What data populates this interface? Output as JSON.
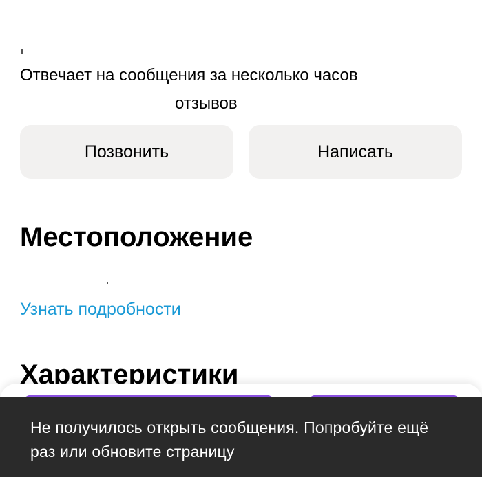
{
  "seller": {
    "response_time": "Отвечает на сообщения за несколько часов",
    "reviews_label": "отзывов"
  },
  "actions": {
    "call_label": "Позвонить",
    "write_label": "Написать"
  },
  "location": {
    "title": "Местоположение",
    "details_link": "Узнать подробности"
  },
  "characteristics": {
    "title": "Характеристики"
  },
  "toast": {
    "message": "Не получилось открыть сообщения. Попробуйте ещё раз или обновите страницу"
  },
  "colors": {
    "link": "#1a9ad6",
    "button_bg": "#f2f1f0",
    "toast_bg": "#2a2a2a",
    "accent_purple": "#8a4fe0"
  }
}
